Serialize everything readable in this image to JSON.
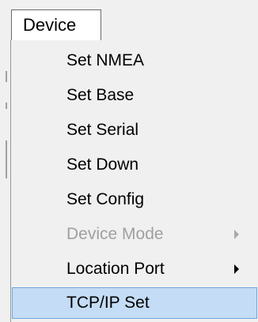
{
  "menubar": {
    "device_label": "Device"
  },
  "menu": {
    "items": [
      {
        "label": "Set NMEA"
      },
      {
        "label": "Set Base"
      },
      {
        "label": "Set Serial"
      },
      {
        "label": "Set Down"
      },
      {
        "label": "Set Config"
      },
      {
        "label": "Device Mode",
        "enabled": false,
        "submenu": true
      },
      {
        "label": "Location Port",
        "enabled": true,
        "submenu": true
      },
      {
        "label": "TCP/IP Set",
        "highlighted": true
      }
    ]
  },
  "colors": {
    "highlight_bg": "#c4dcf5",
    "highlight_border": "#6fa6dd",
    "disabled_text": "#a0a0a0",
    "menu_bg": "#f0f0f0"
  }
}
